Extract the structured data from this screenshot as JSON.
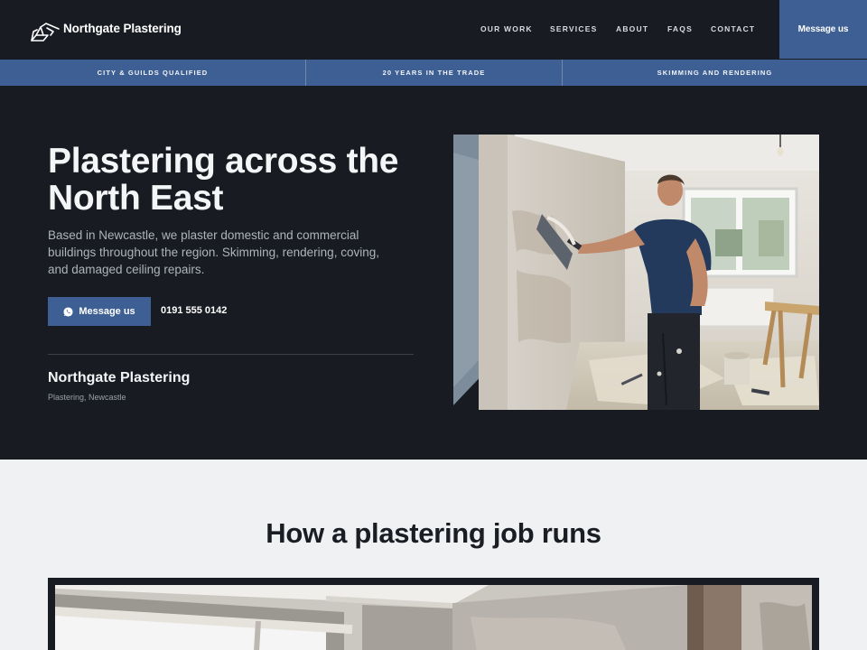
{
  "nav": {
    "brand": "Northgate Plastering",
    "logo_icon": "trowel-house-icon",
    "items": [
      {
        "label": "OUR WORK"
      },
      {
        "label": "SERVICES"
      },
      {
        "label": "ABOUT"
      },
      {
        "label": "FAQS"
      },
      {
        "label": "CONTACT"
      }
    ],
    "cta": "Message us"
  },
  "strip": {
    "items": [
      {
        "label": "CITY & GUILDS QUALIFIED"
      },
      {
        "label": "20 YEARS IN THE TRADE"
      },
      {
        "label": "SKIMMING AND RENDERING"
      }
    ]
  },
  "hero": {
    "title": "Plastering across the North East",
    "text": "Based in Newcastle, we plaster domestic and commercial buildings throughout the region. Skimming, rendering, coving, and damaged ceiling repairs.",
    "button": "Message us",
    "button_icon": "whatsapp-icon",
    "phone": "0191 555 0142",
    "business_name": "Northgate Plastering",
    "business_sub": "Plastering, Newcastle"
  },
  "process": {
    "title": "How a plastering job runs"
  },
  "colors": {
    "dark": "#181b22",
    "accent": "#3d5f93",
    "light_bg": "#f0f1f3"
  }
}
